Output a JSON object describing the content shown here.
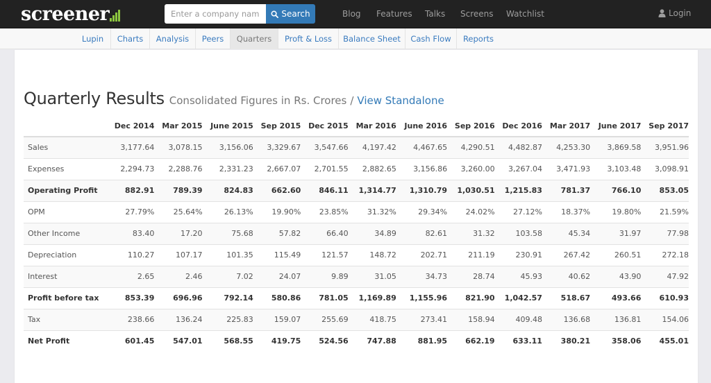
{
  "topbar": {
    "logo_text": "screener",
    "search": {
      "placeholder": "Enter a company name",
      "value": "",
      "button_label": "Search"
    },
    "nav_links": [
      "Blog",
      "Features",
      "Talks",
      "Screens",
      "Watchlist"
    ],
    "login_label": "Login",
    "logo_accent_color": "#8cc63f"
  },
  "subnav": {
    "tabs": [
      {
        "label": "Lupin",
        "active": false
      },
      {
        "label": "Charts",
        "active": false
      },
      {
        "label": "Analysis",
        "active": false
      },
      {
        "label": "Peers",
        "active": false
      },
      {
        "label": "Quarters",
        "active": true
      },
      {
        "label": "Proft & Loss",
        "active": false
      },
      {
        "label": "Balance Sheet",
        "active": false
      },
      {
        "label": "Cash Flow",
        "active": false
      },
      {
        "label": "Reports",
        "active": false
      }
    ]
  },
  "main": {
    "title": "Quarterly Results",
    "subtitle": "Consolidated Figures in Rs. Crores",
    "separator": "/",
    "standalone_link": "View Standalone",
    "table": {
      "columns": [
        "Dec 2014",
        "Mar 2015",
        "June 2015",
        "Sep 2015",
        "Dec 2015",
        "Mar 2016",
        "June 2016",
        "Sep 2016",
        "Dec 2016",
        "Mar 2017",
        "June 2017",
        "Sep 2017"
      ],
      "rows": [
        {
          "label": "Sales",
          "bold": false,
          "values": [
            "3,177.64",
            "3,078.15",
            "3,156.06",
            "3,329.67",
            "3,547.66",
            "4,197.42",
            "4,467.65",
            "4,290.51",
            "4,482.87",
            "4,253.30",
            "3,869.58",
            "3,951.96"
          ]
        },
        {
          "label": "Expenses",
          "bold": false,
          "values": [
            "2,294.73",
            "2,288.76",
            "2,331.23",
            "2,667.07",
            "2,701.55",
            "2,882.65",
            "3,156.86",
            "3,260.00",
            "3,267.04",
            "3,471.93",
            "3,103.48",
            "3,098.91"
          ]
        },
        {
          "label": "Operating Profit",
          "bold": true,
          "values": [
            "882.91",
            "789.39",
            "824.83",
            "662.60",
            "846.11",
            "1,314.77",
            "1,310.79",
            "1,030.51",
            "1,215.83",
            "781.37",
            "766.10",
            "853.05"
          ]
        },
        {
          "label": "OPM",
          "bold": false,
          "values": [
            "27.79%",
            "25.64%",
            "26.13%",
            "19.90%",
            "23.85%",
            "31.32%",
            "29.34%",
            "24.02%",
            "27.12%",
            "18.37%",
            "19.80%",
            "21.59%"
          ]
        },
        {
          "label": "Other Income",
          "bold": false,
          "values": [
            "83.40",
            "17.20",
            "75.68",
            "57.82",
            "66.40",
            "34.89",
            "82.61",
            "31.32",
            "103.58",
            "45.34",
            "31.97",
            "77.98"
          ]
        },
        {
          "label": "Depreciation",
          "bold": false,
          "values": [
            "110.27",
            "107.17",
            "101.35",
            "115.49",
            "121.57",
            "148.72",
            "202.71",
            "211.19",
            "230.91",
            "267.42",
            "260.51",
            "272.18"
          ]
        },
        {
          "label": "Interest",
          "bold": false,
          "values": [
            "2.65",
            "2.46",
            "7.02",
            "24.07",
            "9.89",
            "31.05",
            "34.73",
            "28.74",
            "45.93",
            "40.62",
            "43.90",
            "47.92"
          ]
        },
        {
          "label": "Profit before tax",
          "bold": true,
          "values": [
            "853.39",
            "696.96",
            "792.14",
            "580.86",
            "781.05",
            "1,169.89",
            "1,155.96",
            "821.90",
            "1,042.57",
            "518.67",
            "493.66",
            "610.93"
          ]
        },
        {
          "label": "Tax",
          "bold": false,
          "values": [
            "238.66",
            "136.24",
            "225.83",
            "159.07",
            "255.69",
            "418.75",
            "273.41",
            "158.94",
            "409.48",
            "136.68",
            "136.81",
            "154.06"
          ]
        },
        {
          "label": "Net Profit",
          "bold": true,
          "values": [
            "601.45",
            "547.01",
            "568.55",
            "419.75",
            "524.56",
            "747.88",
            "881.95",
            "662.19",
            "633.11",
            "380.21",
            "358.06",
            "455.01"
          ]
        }
      ]
    }
  }
}
